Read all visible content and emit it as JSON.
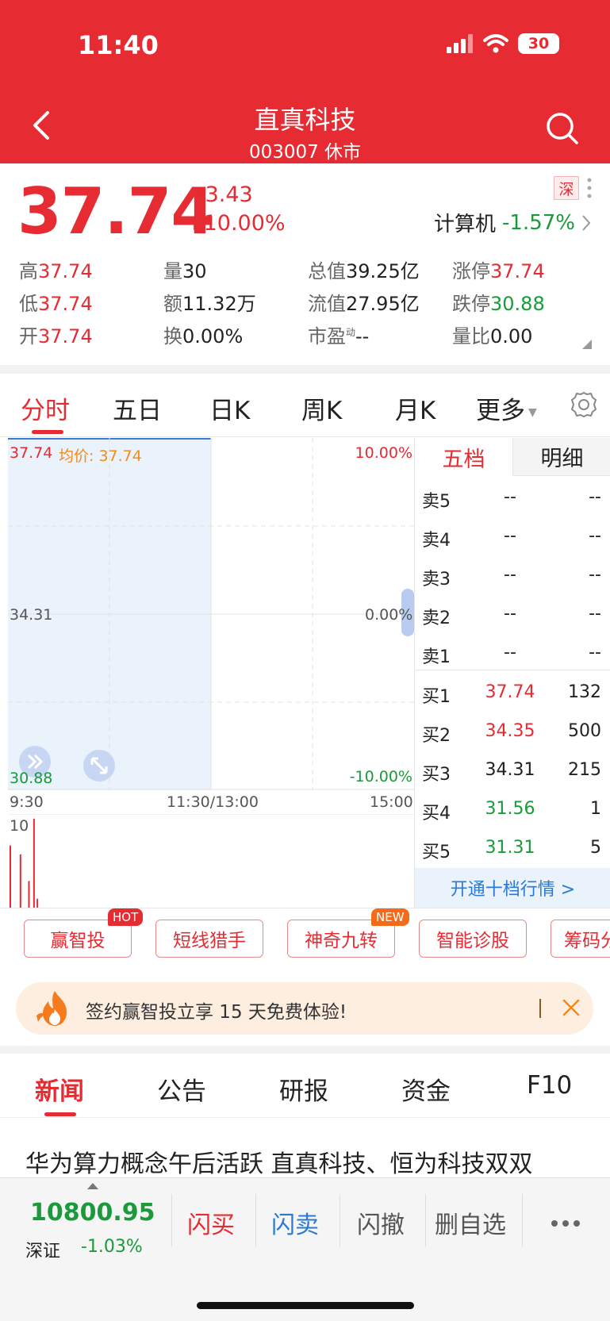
{
  "status_bar": {
    "time": "11:40",
    "battery": "30"
  },
  "header": {
    "name": "直真科技",
    "code_status": "003007  休市"
  },
  "quote": {
    "price": "37.74",
    "change": "+3.43",
    "change_pct": "+10.00%",
    "market_tag": "深",
    "sector": "计算机",
    "sector_pct": "-1.57%"
  },
  "stats": {
    "high_label": "高",
    "high": "37.74",
    "low_label": "低",
    "low": "37.74",
    "open_label": "开",
    "open": "37.74",
    "volume_label": "量",
    "volume": "30",
    "amount_label": "额",
    "amount": "11.32万",
    "turnover_label": "换",
    "turnover": "0.00%",
    "mcap_label": "总值",
    "mcap": "39.25亿",
    "float_label": "流值",
    "float": "27.95亿",
    "pe_label": "市盈",
    "pe_sup": "动",
    "pe": "--",
    "limit_up_label": "涨停",
    "limit_up": "37.74",
    "limit_down_label": "跌停",
    "limit_down": "30.88",
    "vol_ratio_label": "量比",
    "vol_ratio": "0.00"
  },
  "chart_tabs": [
    "分时",
    "五日",
    "日K",
    "周K",
    "月K",
    "更多"
  ],
  "chart": {
    "top_price": "37.74",
    "avg_label": "均价: 37.74",
    "mid_price": "34.31",
    "bottom_price": "30.88",
    "top_pct": "10.00%",
    "mid_pct": "0.00%",
    "bottom_pct": "-10.00%",
    "time_start": "9:30",
    "time_mid": "11:30/13:00",
    "time_end": "15:00",
    "vol_max_label": "10"
  },
  "chart_data": {
    "type": "bar",
    "title": "",
    "ylim": [
      0,
      10
    ],
    "x": [
      "9:30",
      "9:36",
      "9:41",
      "9:44",
      "9:46"
    ],
    "values": [
      7,
      6,
      3,
      10,
      1
    ],
    "color": "#e62b33"
  },
  "order_book": {
    "tabs": [
      "五档",
      "明细"
    ],
    "asks": [
      {
        "label": "卖5",
        "price": "--",
        "vol": "--"
      },
      {
        "label": "卖4",
        "price": "--",
        "vol": "--"
      },
      {
        "label": "卖3",
        "price": "--",
        "vol": "--"
      },
      {
        "label": "卖2",
        "price": "--",
        "vol": "--"
      },
      {
        "label": "卖1",
        "price": "--",
        "vol": "--"
      }
    ],
    "bids": [
      {
        "label": "买1",
        "price": "37.74",
        "vol": "132"
      },
      {
        "label": "买2",
        "price": "34.35",
        "vol": "500"
      },
      {
        "label": "买3",
        "price": "34.31",
        "vol": "215"
      },
      {
        "label": "买4",
        "price": "31.56",
        "vol": "1"
      },
      {
        "label": "买5",
        "price": "31.31",
        "vol": "5"
      }
    ],
    "footer": "开通十档行情 >"
  },
  "features": [
    {
      "label": "赢智投",
      "badge": "HOT"
    },
    {
      "label": "短线猎手",
      "badge": ""
    },
    {
      "label": "神奇九转",
      "badge": "NEW"
    },
    {
      "label": "智能诊股",
      "badge": ""
    },
    {
      "label": "筹码分",
      "badge": ""
    }
  ],
  "promo": {
    "text": "签约赢智投立享 15 天免费体验!"
  },
  "news_tabs": [
    "新闻",
    "公告",
    "研报",
    "资金",
    "F10"
  ],
  "news": {
    "headline": "华为算力概念午后活跃  直真科技、恒为科技双双"
  },
  "bottom": {
    "index_value": "10800.95",
    "index_name": "深证",
    "index_pct": "-1.03%",
    "buttons": [
      "闪买",
      "闪卖",
      "闪撤",
      "删自选"
    ]
  },
  "colors": {
    "brand_red": "#e62b33",
    "up": "#e62b33",
    "down": "#1a9a3a",
    "link_blue": "#2a7ad5"
  },
  "icons": [
    "back-icon",
    "search-icon",
    "signal-icon",
    "wifi-icon",
    "gear-icon",
    "fire-icon",
    "close-icon",
    "more-dots-icon",
    "expand-icon",
    "fullscreen-icon",
    "chevron-right-icon"
  ]
}
